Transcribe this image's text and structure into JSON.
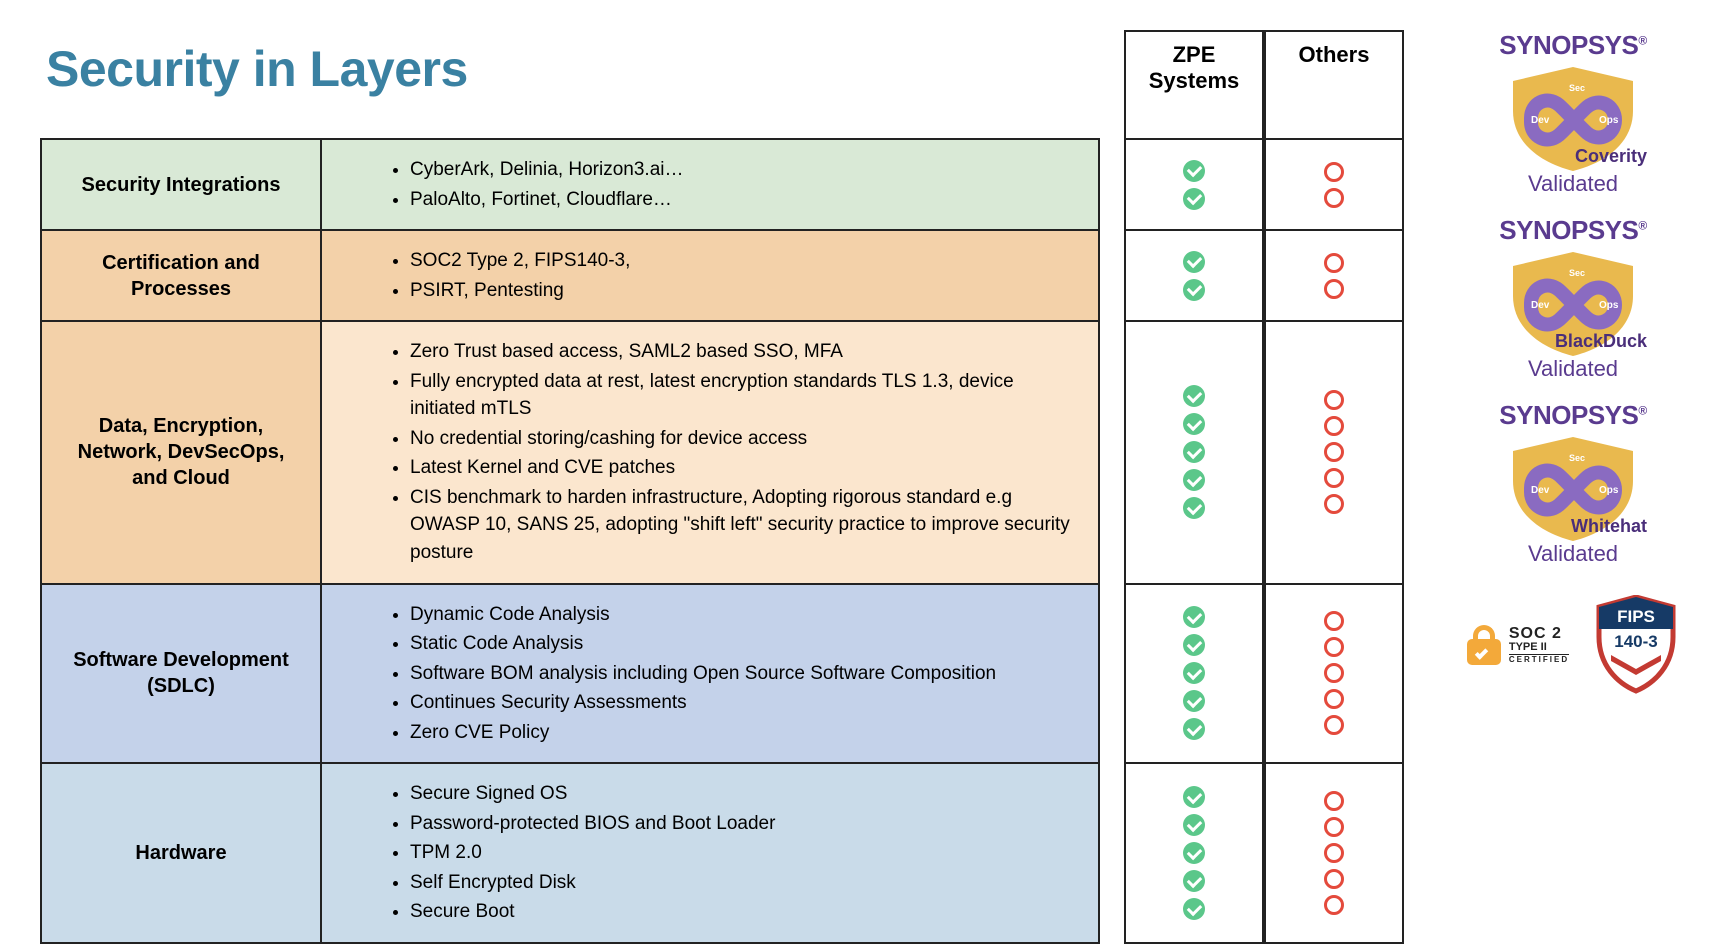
{
  "title": "Security in Layers",
  "rows": [
    {
      "label": "Security Integrations",
      "bgLabel": "bg-green",
      "bgBody": "bg-green",
      "items": [
        "CyberArk, Delinia, Horizon3.ai…",
        "PaloAlto, Fortinet, Cloudflare…"
      ],
      "marks": 2
    },
    {
      "label": "Certification and Processes",
      "bgLabel": "bg-orange",
      "bgBody": "bg-orange",
      "items": [
        "SOC2 Type 2, FIPS140-3,",
        "PSIRT, Pentesting"
      ],
      "marks": 2
    },
    {
      "label": "Data, Encryption, Network, DevSecOps, and Cloud",
      "bgLabel": "bg-orange",
      "bgBody": "bg-orange-lt",
      "items": [
        "Zero Trust based access, SAML2 based SSO, MFA",
        "Fully encrypted data at rest, latest encryption standards TLS 1.3, device initiated mTLS",
        "No credential storing/cashing for device access",
        "Latest Kernel and CVE patches",
        "CIS benchmark to harden infrastructure, Adopting rigorous standard e.g OWASP 10, SANS 25, adopting \"shift left\" security practice to improve security posture"
      ],
      "marks": 5
    },
    {
      "label": "Software Development (SDLC)",
      "bgLabel": "bg-blue",
      "bgBody": "bg-blue",
      "items": [
        "Dynamic Code Analysis",
        "Static Code Analysis",
        "Software BOM analysis including Open Source Software Composition",
        "Continues Security Assessments",
        "Zero CVE Policy"
      ],
      "marks": 5
    },
    {
      "label": "Hardware",
      "bgLabel": "bg-blue-lt",
      "bgBody": "bg-blue-lt",
      "items": [
        "Secure Signed OS",
        "Password-protected BIOS and Boot Loader",
        "TPM 2.0",
        "Self Encrypted Disk",
        "Secure Boot"
      ],
      "marks": 5
    }
  ],
  "cmp": {
    "col1": "ZPE Systems",
    "col2": "Others"
  },
  "badges": {
    "brand": "SYNOPSYS",
    "products": [
      "Coverity",
      "BlackDuck",
      "Whitehat"
    ],
    "validated": "Validated",
    "devsec": {
      "dev": "Dev",
      "sec": "Sec",
      "ops": "Ops"
    }
  },
  "certs": {
    "soc2_l1": "SOC 2",
    "soc2_l2": "TYPE II",
    "soc2_l3": "CERTIFIED",
    "fips_l1": "FIPS",
    "fips_l2": "140-3"
  }
}
